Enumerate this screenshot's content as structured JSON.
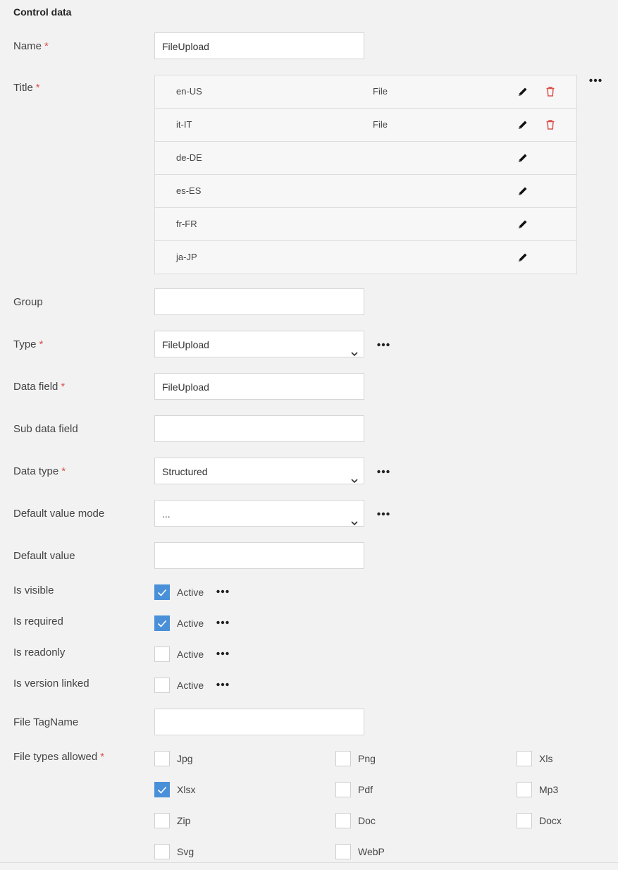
{
  "section": {
    "title": "Control data"
  },
  "fields": {
    "name": {
      "label": "Name",
      "required": "*",
      "value": "FileUpload"
    },
    "title": {
      "label": "Title",
      "required": "*",
      "rows": [
        {
          "lang": "en-US",
          "value": "File"
        },
        {
          "lang": "it-IT",
          "value": "File"
        },
        {
          "lang": "de-DE",
          "value": ""
        },
        {
          "lang": "es-ES",
          "value": ""
        },
        {
          "lang": "fr-FR",
          "value": ""
        },
        {
          "lang": "ja-JP",
          "value": ""
        }
      ]
    },
    "group": {
      "label": "Group",
      "value": ""
    },
    "type": {
      "label": "Type",
      "required": "*",
      "value": "FileUpload"
    },
    "data_field": {
      "label": "Data field",
      "required": "*",
      "value": "FileUpload"
    },
    "sub_data_field": {
      "label": "Sub data field",
      "value": ""
    },
    "data_type": {
      "label": "Data type",
      "required": "*",
      "value": "Structured"
    },
    "default_value_mode": {
      "label": "Default value mode",
      "value": "..."
    },
    "default_value": {
      "label": "Default value",
      "value": ""
    },
    "is_visible": {
      "label": "Is visible",
      "checkbox_label": "Active"
    },
    "is_required": {
      "label": "Is required",
      "checkbox_label": "Active"
    },
    "is_readonly": {
      "label": "Is readonly",
      "checkbox_label": "Active"
    },
    "is_version_linked": {
      "label": "Is version linked",
      "checkbox_label": "Active"
    },
    "file_tagname": {
      "label": "File TagName",
      "value": ""
    },
    "file_types": {
      "label": "File types allowed",
      "required": "*",
      "options": [
        "Jpg",
        "Png",
        "Xls",
        "Xlsx",
        "Pdf",
        "Mp3",
        "Zip",
        "Doc",
        "Docx",
        "Svg",
        "WebP"
      ]
    }
  },
  "colors": {
    "accent": "#4a90d9",
    "required": "#d9534f",
    "delete": "#d9534f",
    "background": "#f2f2f2"
  },
  "icons": {
    "edit": "pencil-icon",
    "delete": "trash-icon",
    "more": "ellipsis-icon",
    "dropdown": "chevron-down-icon",
    "check": "check-icon"
  }
}
